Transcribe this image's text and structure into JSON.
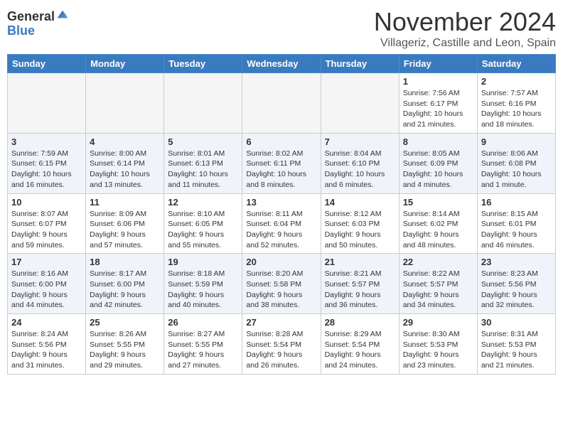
{
  "header": {
    "logo_general": "General",
    "logo_blue": "Blue",
    "month_title": "November 2024",
    "location": "Villageriz, Castille and Leon, Spain"
  },
  "days_of_week": [
    "Sunday",
    "Monday",
    "Tuesday",
    "Wednesday",
    "Thursday",
    "Friday",
    "Saturday"
  ],
  "weeks": [
    [
      {
        "day": "",
        "info": ""
      },
      {
        "day": "",
        "info": ""
      },
      {
        "day": "",
        "info": ""
      },
      {
        "day": "",
        "info": ""
      },
      {
        "day": "",
        "info": ""
      },
      {
        "day": "1",
        "info": "Sunrise: 7:56 AM\nSunset: 6:17 PM\nDaylight: 10 hours and 21 minutes."
      },
      {
        "day": "2",
        "info": "Sunrise: 7:57 AM\nSunset: 6:16 PM\nDaylight: 10 hours and 18 minutes."
      }
    ],
    [
      {
        "day": "3",
        "info": "Sunrise: 7:59 AM\nSunset: 6:15 PM\nDaylight: 10 hours and 16 minutes."
      },
      {
        "day": "4",
        "info": "Sunrise: 8:00 AM\nSunset: 6:14 PM\nDaylight: 10 hours and 13 minutes."
      },
      {
        "day": "5",
        "info": "Sunrise: 8:01 AM\nSunset: 6:13 PM\nDaylight: 10 hours and 11 minutes."
      },
      {
        "day": "6",
        "info": "Sunrise: 8:02 AM\nSunset: 6:11 PM\nDaylight: 10 hours and 8 minutes."
      },
      {
        "day": "7",
        "info": "Sunrise: 8:04 AM\nSunset: 6:10 PM\nDaylight: 10 hours and 6 minutes."
      },
      {
        "day": "8",
        "info": "Sunrise: 8:05 AM\nSunset: 6:09 PM\nDaylight: 10 hours and 4 minutes."
      },
      {
        "day": "9",
        "info": "Sunrise: 8:06 AM\nSunset: 6:08 PM\nDaylight: 10 hours and 1 minute."
      }
    ],
    [
      {
        "day": "10",
        "info": "Sunrise: 8:07 AM\nSunset: 6:07 PM\nDaylight: 9 hours and 59 minutes."
      },
      {
        "day": "11",
        "info": "Sunrise: 8:09 AM\nSunset: 6:06 PM\nDaylight: 9 hours and 57 minutes."
      },
      {
        "day": "12",
        "info": "Sunrise: 8:10 AM\nSunset: 6:05 PM\nDaylight: 9 hours and 55 minutes."
      },
      {
        "day": "13",
        "info": "Sunrise: 8:11 AM\nSunset: 6:04 PM\nDaylight: 9 hours and 52 minutes."
      },
      {
        "day": "14",
        "info": "Sunrise: 8:12 AM\nSunset: 6:03 PM\nDaylight: 9 hours and 50 minutes."
      },
      {
        "day": "15",
        "info": "Sunrise: 8:14 AM\nSunset: 6:02 PM\nDaylight: 9 hours and 48 minutes."
      },
      {
        "day": "16",
        "info": "Sunrise: 8:15 AM\nSunset: 6:01 PM\nDaylight: 9 hours and 46 minutes."
      }
    ],
    [
      {
        "day": "17",
        "info": "Sunrise: 8:16 AM\nSunset: 6:00 PM\nDaylight: 9 hours and 44 minutes."
      },
      {
        "day": "18",
        "info": "Sunrise: 8:17 AM\nSunset: 6:00 PM\nDaylight: 9 hours and 42 minutes."
      },
      {
        "day": "19",
        "info": "Sunrise: 8:18 AM\nSunset: 5:59 PM\nDaylight: 9 hours and 40 minutes."
      },
      {
        "day": "20",
        "info": "Sunrise: 8:20 AM\nSunset: 5:58 PM\nDaylight: 9 hours and 38 minutes."
      },
      {
        "day": "21",
        "info": "Sunrise: 8:21 AM\nSunset: 5:57 PM\nDaylight: 9 hours and 36 minutes."
      },
      {
        "day": "22",
        "info": "Sunrise: 8:22 AM\nSunset: 5:57 PM\nDaylight: 9 hours and 34 minutes."
      },
      {
        "day": "23",
        "info": "Sunrise: 8:23 AM\nSunset: 5:56 PM\nDaylight: 9 hours and 32 minutes."
      }
    ],
    [
      {
        "day": "24",
        "info": "Sunrise: 8:24 AM\nSunset: 5:56 PM\nDaylight: 9 hours and 31 minutes."
      },
      {
        "day": "25",
        "info": "Sunrise: 8:26 AM\nSunset: 5:55 PM\nDaylight: 9 hours and 29 minutes."
      },
      {
        "day": "26",
        "info": "Sunrise: 8:27 AM\nSunset: 5:55 PM\nDaylight: 9 hours and 27 minutes."
      },
      {
        "day": "27",
        "info": "Sunrise: 8:28 AM\nSunset: 5:54 PM\nDaylight: 9 hours and 26 minutes."
      },
      {
        "day": "28",
        "info": "Sunrise: 8:29 AM\nSunset: 5:54 PM\nDaylight: 9 hours and 24 minutes."
      },
      {
        "day": "29",
        "info": "Sunrise: 8:30 AM\nSunset: 5:53 PM\nDaylight: 9 hours and 23 minutes."
      },
      {
        "day": "30",
        "info": "Sunrise: 8:31 AM\nSunset: 5:53 PM\nDaylight: 9 hours and 21 minutes."
      }
    ]
  ]
}
